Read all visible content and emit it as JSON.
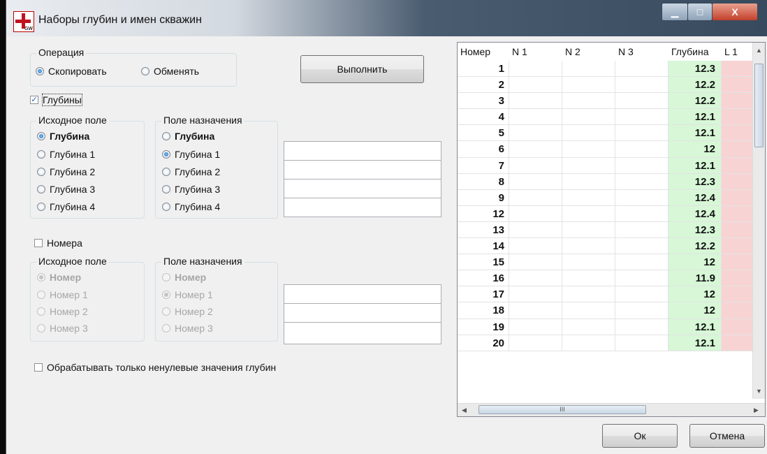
{
  "window": {
    "title": "Наборы глубин и имен скважин",
    "icon_label": "GW",
    "controls": {
      "minimize": "▁",
      "maximize": "□",
      "close": "X"
    }
  },
  "operation": {
    "title": "Операция",
    "options": [
      "Скопировать",
      "Обменять"
    ],
    "selected": "Скопировать"
  },
  "execute_label": "Выполнить",
  "depths": {
    "checkbox_label": "Глубины",
    "checked": true,
    "source": {
      "title": "Исходное поле",
      "options": [
        "Глубина",
        "Глубина 1",
        "Глубина 2",
        "Глубина 3",
        "Глубина 4"
      ],
      "selected": "Глубина"
    },
    "target": {
      "title": "Поле назначения",
      "options": [
        "Глубина",
        "Глубина 1",
        "Глубина 2",
        "Глубина 3",
        "Глубина 4"
      ],
      "selected": "Глубина 1"
    },
    "fields": [
      "",
      "",
      "",
      ""
    ]
  },
  "numbers": {
    "checkbox_label": "Номера",
    "checked": false,
    "source": {
      "title": "Исходное поле",
      "options": [
        "Номер",
        "Номер 1",
        "Номер 2",
        "Номер 3"
      ],
      "selected": "Номер"
    },
    "target": {
      "title": "Поле назначения",
      "options": [
        "Номер",
        "Номер 1",
        "Номер 2",
        "Номер 3"
      ],
      "selected": "Номер 1"
    },
    "fields": [
      "",
      "",
      ""
    ]
  },
  "nonzero_label": "Обрабатывать только ненулевые значения глубин",
  "nonzero_checked": false,
  "grid": {
    "columns": [
      "Номер",
      "N 1",
      "N 2",
      "N 3",
      "Глубина",
      "L 1"
    ],
    "rows": [
      {
        "num": "1",
        "n1": "",
        "n2": "",
        "n3": "",
        "depth": "12.3",
        "l1": ""
      },
      {
        "num": "2",
        "n1": "",
        "n2": "",
        "n3": "",
        "depth": "12.2",
        "l1": ""
      },
      {
        "num": "3",
        "n1": "",
        "n2": "",
        "n3": "",
        "depth": "12.2",
        "l1": ""
      },
      {
        "num": "4",
        "n1": "",
        "n2": "",
        "n3": "",
        "depth": "12.1",
        "l1": ""
      },
      {
        "num": "5",
        "n1": "",
        "n2": "",
        "n3": "",
        "depth": "12.1",
        "l1": ""
      },
      {
        "num": "6",
        "n1": "",
        "n2": "",
        "n3": "",
        "depth": "12",
        "l1": ""
      },
      {
        "num": "7",
        "n1": "",
        "n2": "",
        "n3": "",
        "depth": "12.1",
        "l1": ""
      },
      {
        "num": "8",
        "n1": "",
        "n2": "",
        "n3": "",
        "depth": "12.3",
        "l1": ""
      },
      {
        "num": "9",
        "n1": "",
        "n2": "",
        "n3": "",
        "depth": "12.4",
        "l1": ""
      },
      {
        "num": "12",
        "n1": "",
        "n2": "",
        "n3": "",
        "depth": "12.4",
        "l1": ""
      },
      {
        "num": "13",
        "n1": "",
        "n2": "",
        "n3": "",
        "depth": "12.3",
        "l1": ""
      },
      {
        "num": "14",
        "n1": "",
        "n2": "",
        "n3": "",
        "depth": "12.2",
        "l1": ""
      },
      {
        "num": "15",
        "n1": "",
        "n2": "",
        "n3": "",
        "depth": "12",
        "l1": ""
      },
      {
        "num": "16",
        "n1": "",
        "n2": "",
        "n3": "",
        "depth": "11.9",
        "l1": ""
      },
      {
        "num": "17",
        "n1": "",
        "n2": "",
        "n3": "",
        "depth": "12",
        "l1": ""
      },
      {
        "num": "18",
        "n1": "",
        "n2": "",
        "n3": "",
        "depth": "12",
        "l1": ""
      },
      {
        "num": "19",
        "n1": "",
        "n2": "",
        "n3": "",
        "depth": "12.1",
        "l1": ""
      },
      {
        "num": "20",
        "n1": "",
        "n2": "",
        "n3": "",
        "depth": "12.1",
        "l1": ""
      }
    ],
    "hscroll_glyph": "III",
    "colors": {
      "depth_cell": "#d7f7d7",
      "l1_cell": "#f8d3d3"
    }
  },
  "ok_label": "Ок",
  "cancel_label": "Отмена"
}
